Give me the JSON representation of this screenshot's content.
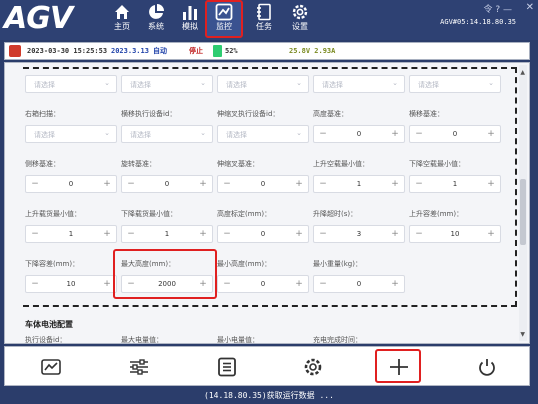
{
  "app": {
    "logo": "AGV"
  },
  "nav": [
    {
      "label": "主页",
      "icon": "home-icon"
    },
    {
      "label": "系统",
      "icon": "pie-chart-icon"
    },
    {
      "label": "模拟",
      "icon": "bar-chart-icon"
    },
    {
      "label": "监控",
      "icon": "monitor-icon"
    },
    {
      "label": "任务",
      "icon": "task-icon"
    },
    {
      "label": "设置",
      "icon": "settings-icon"
    }
  ],
  "header": {
    "version": "AGV#05:14.18.80.35",
    "wifi": "令 ? —",
    "close": "✕"
  },
  "status": {
    "datetime": "2023-03-30 15:25:53",
    "version_date": "2023.3.13",
    "mode": "自动",
    "state": "停止",
    "battery": "52%",
    "voltage": "25.8V 2.93A"
  },
  "form": {
    "select_placeholder": "请选择",
    "row2_labels": [
      "右箱扫描：",
      "横移执行设备id：",
      "伸缩叉执行设备id：",
      "高度基准：",
      "横移基准："
    ],
    "row3_labels": [
      "侧移基准：",
      "旋转基准：",
      "伸缩叉基准：",
      "上升空载最小值：",
      "下降空载最小值："
    ],
    "row4_labels": [
      "上升载货最小值：",
      "下降载货最小值：",
      "高度标定(mm)：",
      "升降超时(s)：",
      "上升容差(mm)："
    ],
    "row5_labels": [
      "下降容差(mm)：",
      "最大高度(mm)：",
      "最小高度(mm)：",
      "最小重量(kg)："
    ],
    "row2_values": [
      "0",
      "0"
    ],
    "row3_values": [
      "0",
      "0",
      "0",
      "1",
      "1"
    ],
    "row4_values": [
      "1",
      "1",
      "0",
      "3",
      "10"
    ],
    "row5_values": [
      "10",
      "2000",
      "0",
      "0"
    ],
    "section_title": "车体电池配置",
    "next_labels": [
      "执行设备id：",
      "最大电量值：",
      "最小电量值：",
      "充电完成时间："
    ]
  },
  "toolbar": [
    "chart-icon",
    "sliders-icon",
    "list-icon",
    "gear-icon",
    "add-icon",
    "power-icon"
  ],
  "footer": {
    "text": "(14.18.80.35)获取运行数据 ..."
  },
  "colors": {
    "header_bg": "#2e4173",
    "highlight": "#e02020",
    "battery": "#2ecc71"
  }
}
